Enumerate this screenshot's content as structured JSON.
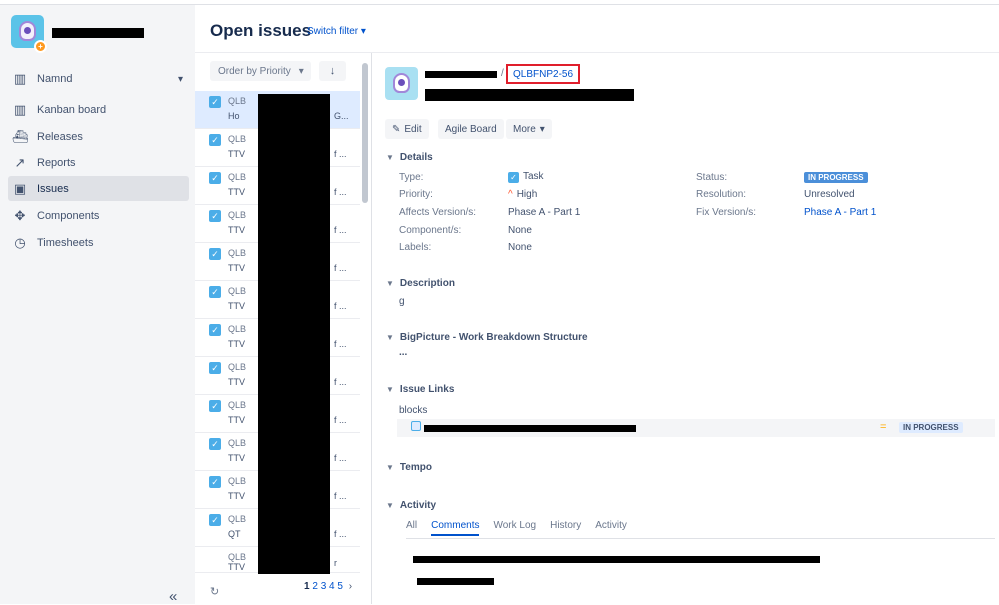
{
  "sidebar": {
    "board_select": "Namnd",
    "items": [
      {
        "label": "Kanban board",
        "icon": "kanban-icon"
      },
      {
        "label": "Releases",
        "icon": "ship-icon"
      },
      {
        "label": "Reports",
        "icon": "chart-icon"
      },
      {
        "label": "Issues",
        "icon": "issues-icon"
      },
      {
        "label": "Components",
        "icon": "puzzle-icon"
      },
      {
        "label": "Timesheets",
        "icon": "clock-icon"
      }
    ],
    "active_item": "Issues"
  },
  "header": {
    "title": "Open issues",
    "switch_filter": "Switch filter"
  },
  "list": {
    "order_label": "Order by Priority",
    "rows": [
      {
        "key": "QLB",
        "summary": "Ho",
        "end": "G..."
      },
      {
        "key": "QLB",
        "summary": "TTV",
        "end": "f ..."
      },
      {
        "key": "QLB",
        "summary": "TTV",
        "end": "f ..."
      },
      {
        "key": "QLB",
        "summary": "TTV",
        "end": "f ..."
      },
      {
        "key": "QLB",
        "summary": "TTV",
        "end": "f ..."
      },
      {
        "key": "QLB",
        "summary": "TTV",
        "end": "f ..."
      },
      {
        "key": "QLB",
        "summary": "TTV",
        "end": "f ..."
      },
      {
        "key": "QLB",
        "summary": "TTV",
        "end": "f ..."
      },
      {
        "key": "QLB",
        "summary": "TTV",
        "end": "f ..."
      },
      {
        "key": "QLB",
        "summary": "TTV",
        "end": "f ..."
      },
      {
        "key": "QLB",
        "summary": "TTV",
        "end": "f ..."
      },
      {
        "key": "QLB",
        "summary": "QT",
        "end": "f ..."
      },
      {
        "key": "QLB",
        "summary": "TTV",
        "end": "r"
      }
    ],
    "pager": {
      "current": "1",
      "pages": [
        "2",
        "3",
        "4",
        "5"
      ],
      "next": "›"
    }
  },
  "detail": {
    "issue_key": "QLBFNP2-56",
    "buttons": {
      "edit": "Edit",
      "agile_board": "Agile Board",
      "more": "More"
    },
    "details_heading": "Details",
    "fields": {
      "type_label": "Type:",
      "type_value": "Task",
      "priority_label": "Priority:",
      "priority_value": "High",
      "affects_label": "Affects Version/s:",
      "affects_value": "Phase A - Part 1",
      "component_label": "Component/s:",
      "component_value": "None",
      "labels_label": "Labels:",
      "labels_value": "None",
      "status_label": "Status:",
      "status_value": "IN PROGRESS",
      "resolution_label": "Resolution:",
      "resolution_value": "Unresolved",
      "fix_label": "Fix Version/s:",
      "fix_value": "Phase A - Part 1"
    },
    "description_heading": "Description",
    "description_text": "g",
    "bigpicture_heading": "BigPicture - Work Breakdown Structure",
    "bigpicture_text": "...",
    "links_heading": "Issue Links",
    "links_type": "blocks",
    "link_status": "IN PROGRESS",
    "link_priority_icon": "=",
    "tempo_heading": "Tempo",
    "activity_heading": "Activity",
    "activity_tabs": [
      "All",
      "Comments",
      "Work Log",
      "History",
      "Activity"
    ],
    "activity_active": "Comments"
  }
}
